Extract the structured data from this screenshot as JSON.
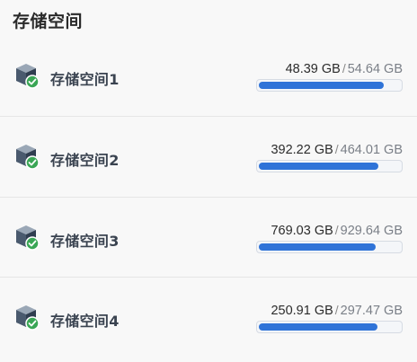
{
  "panel": {
    "title": "存储空间"
  },
  "volumes": [
    {
      "name": "存储空间1",
      "used": "48.39 GB",
      "separator": "/",
      "total": "54.64 GB",
      "usage_fraction": 0.8856,
      "status_icon": "check-circle-icon"
    },
    {
      "name": "存储空间2",
      "used": "392.22 GB",
      "separator": "/",
      "total": "464.01 GB",
      "usage_fraction": 0.8453,
      "status_icon": "check-circle-icon"
    },
    {
      "name": "存储空间3",
      "used": "769.03 GB",
      "separator": "/",
      "total": "929.64 GB",
      "usage_fraction": 0.8272,
      "status_icon": "check-circle-icon"
    },
    {
      "name": "存储空间4",
      "used": "250.91 GB",
      "separator": "/",
      "total": "297.47 GB",
      "usage_fraction": 0.8435,
      "status_icon": "check-circle-icon"
    }
  ],
  "colors": {
    "accent": "#2f73d8",
    "status_ok": "#3aa655",
    "cube_dark": "#3b4a5c"
  }
}
